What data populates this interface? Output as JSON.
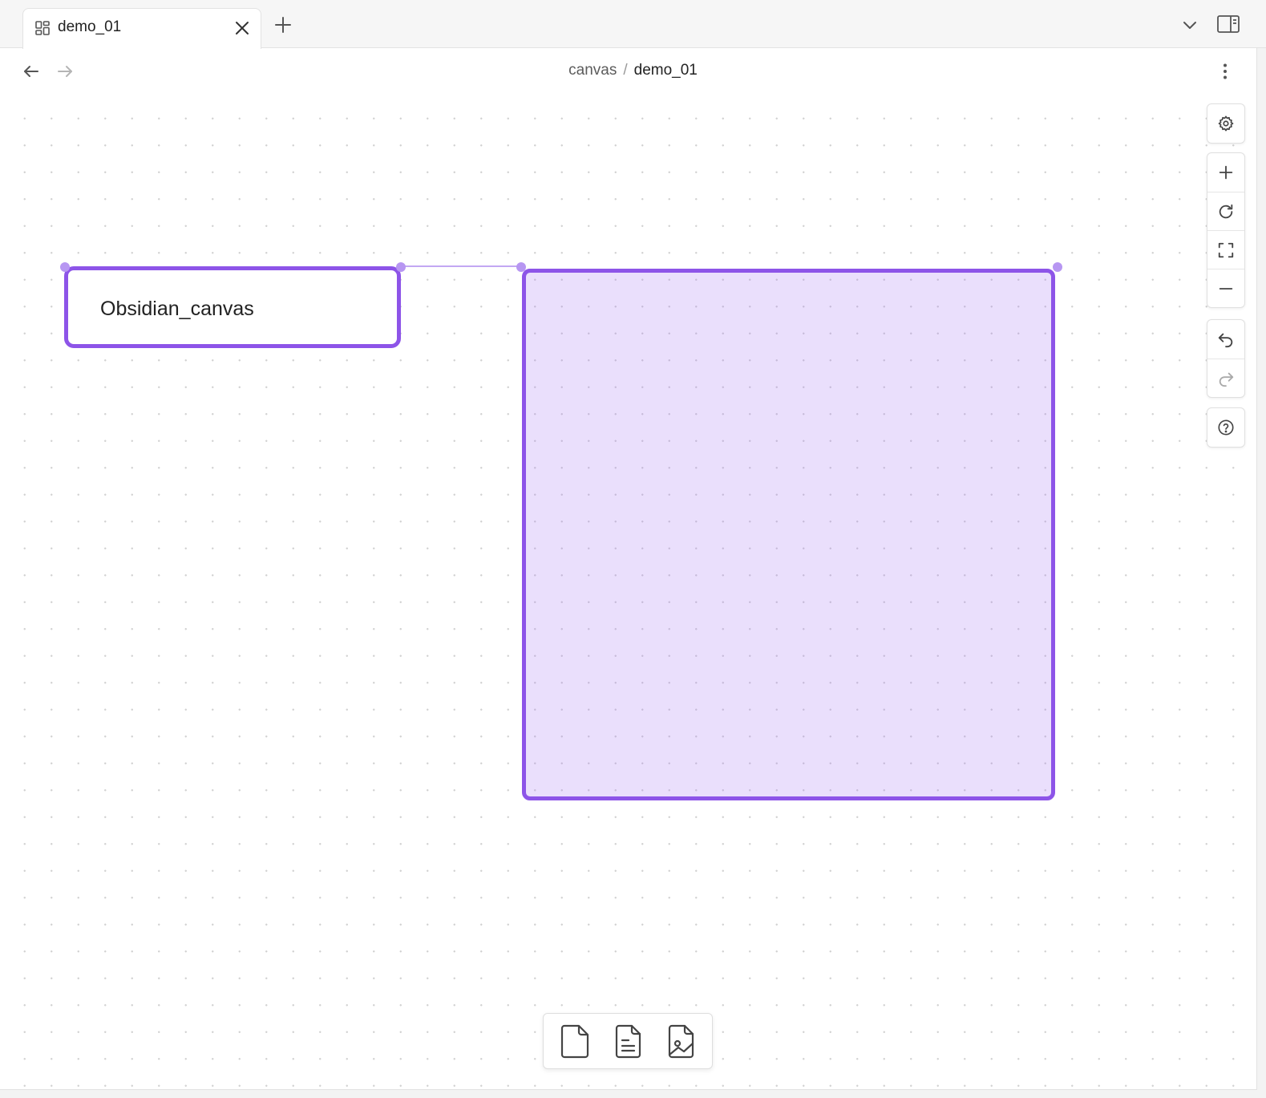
{
  "tab": {
    "title": "demo_01",
    "icon": "canvas-layout-icon"
  },
  "breadcrumb": {
    "parent": "canvas",
    "separator": "/",
    "current": "demo_01"
  },
  "canvas": {
    "text_node": {
      "text": "Obsidian_canvas"
    },
    "group_node": {
      "label": ""
    },
    "accent_color": "#8d54e8",
    "group_fill": "#e7dcfb"
  },
  "controls": {
    "settings": "gear-icon",
    "zoom_in": "plus-icon",
    "reset_zoom": "rotate-cw-icon",
    "zoom_to_fit": "maximize-icon",
    "zoom_out": "minus-icon",
    "undo": "undo-icon",
    "redo": "redo-icon",
    "help": "help-circle-icon"
  },
  "card_menu": {
    "items": [
      "blank-card-icon",
      "note-file-icon",
      "media-file-icon"
    ]
  }
}
